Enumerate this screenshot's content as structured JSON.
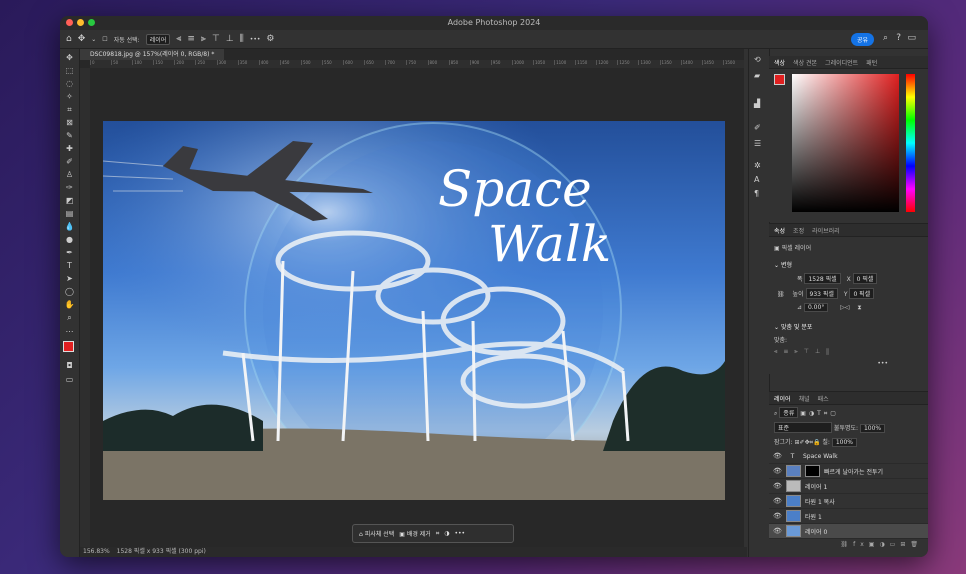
{
  "app": {
    "title": "Adobe Photoshop 2024"
  },
  "options_bar": {
    "auto_select_label": "자동 선택:",
    "auto_select_value": "레이어",
    "more": "•••",
    "share_label": "공유"
  },
  "document": {
    "tab_label": "DSC09818.jpg @ 157%(레이어 0, RGB/8) *",
    "status_zoom": "156.83%",
    "status_info": "1528 픽셀 x 933 픽셀 (300 ppi)",
    "ruler_ticks": [
      "0",
      "50",
      "100",
      "150",
      "200",
      "250",
      "300",
      "350",
      "400",
      "450",
      "500",
      "550",
      "600",
      "650",
      "700",
      "750",
      "800",
      "850",
      "900",
      "950",
      "1000",
      "1050",
      "1100",
      "1150",
      "1200",
      "1250",
      "1300",
      "1350",
      "1400",
      "1450",
      "1500"
    ]
  },
  "canvas_text": {
    "line1": "Space",
    "line2": "Walk"
  },
  "context_bar": {
    "select_subject": "피사체 선택",
    "remove_bg": "배경 제거",
    "more": "•••"
  },
  "color_panel": {
    "tabs": [
      "색상",
      "색상 견본",
      "그레이디언트",
      "패턴"
    ]
  },
  "properties_panel": {
    "tabs": [
      "속성",
      "조정",
      "라이브러리"
    ],
    "layer_type": "픽셀 레이어",
    "transform_title": "변형",
    "w_label": "폭",
    "w": "1528 픽셀",
    "h_label": "높이",
    "h": "933 픽셀",
    "x_label": "X",
    "x": "0 픽셀",
    "y_label": "Y",
    "y": "0 픽셀",
    "angle": "0.00°",
    "align_title": "맞춤 및 분포",
    "align_label": "맞춤:",
    "more": "•••"
  },
  "layers_panel": {
    "tabs": [
      "레이어",
      "채널",
      "패스"
    ],
    "filter_label": "종류",
    "blend_mode": "표준",
    "opacity_label": "불투명도:",
    "opacity": "100%",
    "lock_label": "잠그기:",
    "fill_label": "칠:",
    "fill": "100%",
    "layers": [
      {
        "name": "Space       Walk",
        "type": "text"
      },
      {
        "name": "빠르게 날아가는 전투기",
        "type": "masked"
      },
      {
        "name": "레이어 1",
        "type": "pixel"
      },
      {
        "name": "타원 1 복사",
        "type": "shape"
      },
      {
        "name": "타원 1",
        "type": "shape"
      },
      {
        "name": "레이어 0",
        "type": "pixel",
        "selected": true
      }
    ]
  },
  "colors": {
    "accent": "#1473e6",
    "foreground": "#e02020",
    "background": "#000000"
  }
}
